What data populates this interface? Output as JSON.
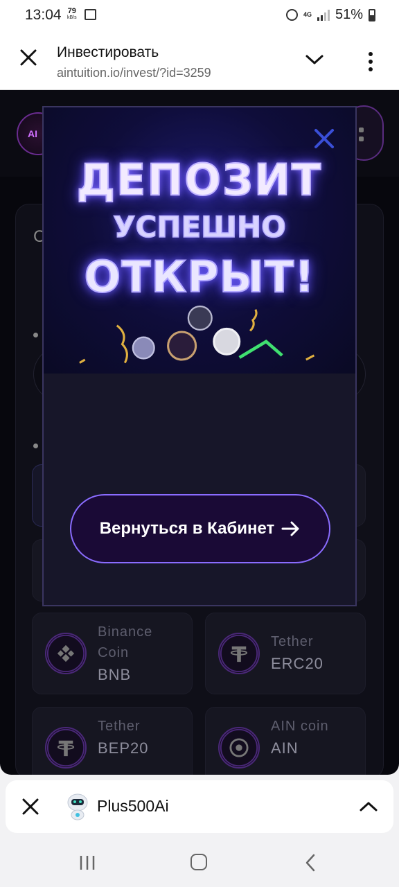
{
  "status_bar": {
    "time": "13:04",
    "speed_value": "79",
    "speed_unit": "kB/s",
    "network": "4G",
    "battery": "51%"
  },
  "browser_header": {
    "title": "Инвестировать",
    "url": "aintuition.io/invest/?id=3259"
  },
  "background_page": {
    "tiles": [
      {
        "line1": "Binance",
        "line2": "Coin",
        "line3": "BNB",
        "icon": "binance-icon"
      },
      {
        "line1": "Tether",
        "line2": "ERC20",
        "icon": "tether-icon"
      },
      {
        "line1": "Tether",
        "line2": "BEP20",
        "icon": "tether-icon"
      },
      {
        "line1": "AIN coin",
        "line2": "AIN",
        "icon": "ain-coin-icon"
      }
    ]
  },
  "modal": {
    "heading_line1": "ДЕПОЗИТ",
    "heading_line2": "УСПЕШНО",
    "heading_line3": "ОТКРЫТ!",
    "button_label": "Вернуться в Кабинет",
    "accent_color": "#8a6cff",
    "close_color": "#3a4fd8"
  },
  "bottom_sheet": {
    "app_name": "Plus500Ai"
  }
}
